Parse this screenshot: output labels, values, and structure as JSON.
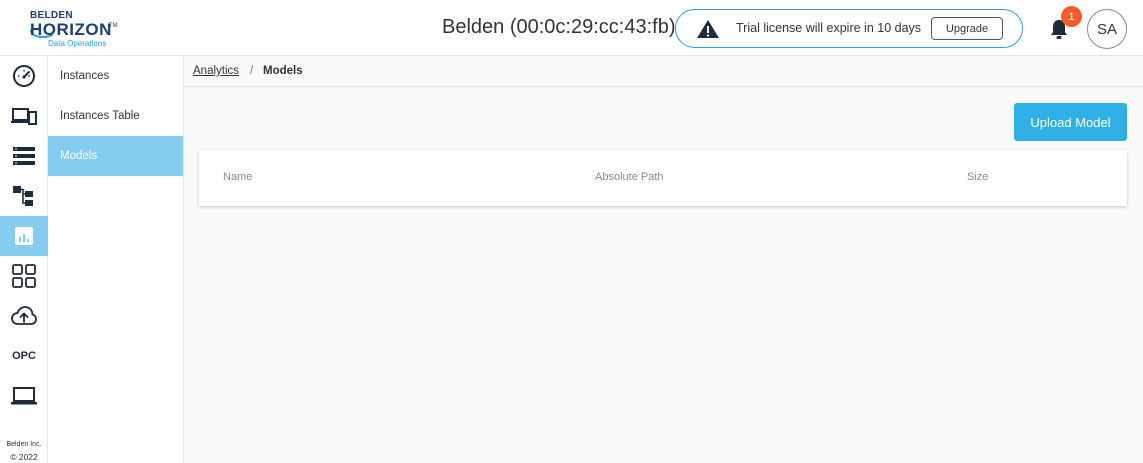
{
  "header": {
    "logo": {
      "top": "BELDEN",
      "main": "HORIZON",
      "tm": "TM",
      "sub": "Data Operations"
    },
    "device_title": "Belden (00:0c:29:cc:43:fb)",
    "license_text": "Trial license will expire in 10 days",
    "upgrade_label": "Upgrade",
    "notification_count": "1",
    "avatar_initials": "SA"
  },
  "rail": {
    "items": [
      {
        "icon": "dashboard-gauge-icon"
      },
      {
        "icon": "devices-icon"
      },
      {
        "icon": "server-list-icon"
      },
      {
        "icon": "hierarchy-icon"
      },
      {
        "icon": "analytics-chart-icon",
        "active": true
      },
      {
        "icon": "apps-grid-icon"
      },
      {
        "icon": "cloud-upload-icon"
      },
      {
        "icon": "opc-icon",
        "label": "OPC"
      },
      {
        "icon": "laptop-icon"
      }
    ],
    "footer_company": "Belden Inc.",
    "footer_year": "© 2022"
  },
  "submenu": {
    "items": [
      {
        "label": "Instances"
      },
      {
        "label": "Instances Table"
      },
      {
        "label": "Models",
        "active": true
      }
    ]
  },
  "breadcrumb": {
    "parent": "Analytics",
    "separator": "/",
    "current": "Models"
  },
  "main": {
    "upload_label": "Upload Model",
    "table": {
      "columns": [
        "Name",
        "Absolute Path",
        "Size"
      ],
      "rows": []
    }
  },
  "colors": {
    "accent": "#2fb1e7",
    "active_bg": "#85cdef",
    "badge": "#f25c2b",
    "brand_navy": "#1d3f6e"
  }
}
